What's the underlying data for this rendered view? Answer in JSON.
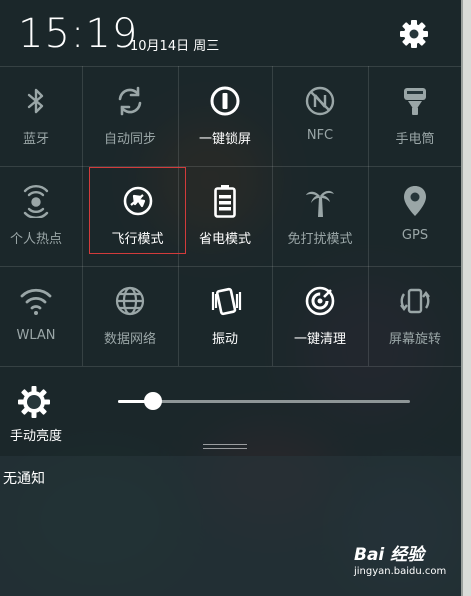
{
  "status_bar": {
    "time": "15:19",
    "date": "10月14日 周三"
  },
  "quick_settings": [
    [
      {
        "label": "蓝牙",
        "icon": "bluetooth-icon",
        "active": false
      },
      {
        "label": "自动同步",
        "icon": "sync-icon",
        "active": false
      },
      {
        "label": "一键锁屏",
        "icon": "power-lock-icon",
        "active": true
      },
      {
        "label": "NFC",
        "icon": "nfc-icon",
        "active": false
      },
      {
        "label": "手电筒",
        "icon": "flashlight-icon",
        "active": false
      }
    ],
    [
      {
        "label": "个人热点",
        "icon": "hotspot-icon",
        "active": false
      },
      {
        "label": "飞行模式",
        "icon": "airplane-icon",
        "active": true
      },
      {
        "label": "省电模式",
        "icon": "battery-icon",
        "active": true
      },
      {
        "label": "免打扰模式",
        "icon": "palm-tree-icon",
        "active": false
      },
      {
        "label": "GPS",
        "icon": "location-pin-icon",
        "active": false
      }
    ],
    [
      {
        "label": "WLAN",
        "icon": "wifi-icon",
        "active": false
      },
      {
        "label": "数据网络",
        "icon": "globe-icon",
        "active": false
      },
      {
        "label": "振动",
        "icon": "vibrate-icon",
        "active": true
      },
      {
        "label": "一键清理",
        "icon": "clean-icon",
        "active": true
      },
      {
        "label": "屏幕旋转",
        "icon": "rotate-screen-icon",
        "active": false
      }
    ]
  ],
  "brightness": {
    "label": "手动亮度",
    "level": 0.12
  },
  "notifications": {
    "empty_text": "无通知"
  },
  "watermark": {
    "logo": "Bai 经验",
    "url": "jingyan.baidu.com"
  },
  "colors": {
    "active": "#ffffff",
    "inactive": "#9aa6a7",
    "highlight_box": "#d23b3b"
  }
}
